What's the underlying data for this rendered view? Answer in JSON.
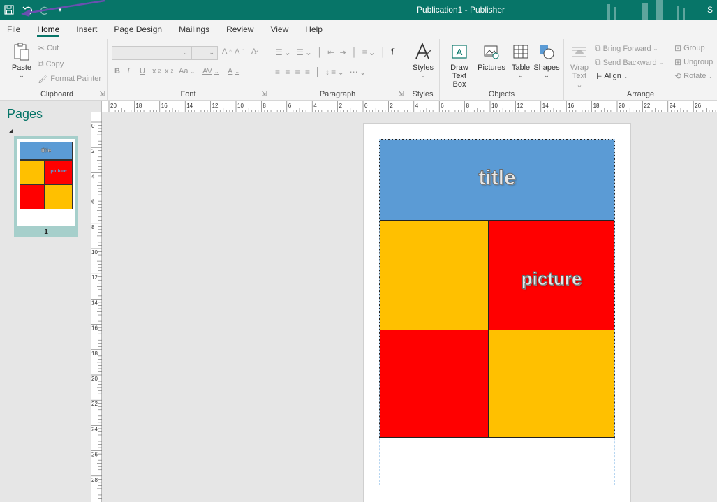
{
  "window": {
    "title": "Publication1 - Publisher",
    "right_initial": "S"
  },
  "qat": {
    "save_icon": "save-icon",
    "undo_icon": "undo-icon",
    "redo_icon": "redo-icon",
    "customize_icon": "customize-qat-icon"
  },
  "tabs": [
    "File",
    "Home",
    "Insert",
    "Page Design",
    "Mailings",
    "Review",
    "View",
    "Help"
  ],
  "active_tab": "Home",
  "ribbon": {
    "clipboard": {
      "label": "Clipboard",
      "paste": "Paste",
      "cut": "Cut",
      "copy": "Copy",
      "format_painter": "Format Painter"
    },
    "font": {
      "label": "Font",
      "bold": "B",
      "italic": "I",
      "underline": "U",
      "subscript": "x",
      "superscript": "x",
      "change_case": "Aa",
      "spacing": "AV",
      "font_color": "A",
      "grow": "A",
      "shrink": "A"
    },
    "paragraph": {
      "label": "Paragraph",
      "pilcrow": "¶"
    },
    "styles": {
      "label": "Styles",
      "button": "Styles"
    },
    "objects": {
      "label": "Objects",
      "draw_text_box_line1": "Draw",
      "draw_text_box_line2": "Text Box",
      "pictures": "Pictures",
      "table": "Table",
      "shapes": "Shapes"
    },
    "arrange": {
      "label": "Arrange",
      "wrap_text_line1": "Wrap",
      "wrap_text_line2": "Text",
      "bring_forward": "Bring Forward",
      "send_backward": "Send Backward",
      "align": "Align",
      "group": "Group",
      "ungroup": "Ungroup",
      "rotate": "Rotate"
    }
  },
  "pages_panel": {
    "title": "Pages",
    "page_number": "1"
  },
  "rulers": {
    "horizontal": [
      "20",
      "18",
      "16",
      "14",
      "12",
      "10",
      "8",
      "6",
      "4",
      "2",
      "0",
      "2",
      "4",
      "6",
      "8",
      "10",
      "12",
      "14",
      "16",
      "18",
      "20",
      "22",
      "24",
      "26"
    ],
    "vertical": [
      "0",
      "2",
      "4",
      "6",
      "8",
      "10",
      "12",
      "14",
      "16",
      "18",
      "20",
      "22",
      "24",
      "26",
      "28"
    ]
  },
  "publication": {
    "title_text": "title",
    "picture_text": "picture",
    "colors": {
      "title_bg": "#5b9bd5",
      "yellow": "#ffc000",
      "red": "#ff0000"
    }
  }
}
